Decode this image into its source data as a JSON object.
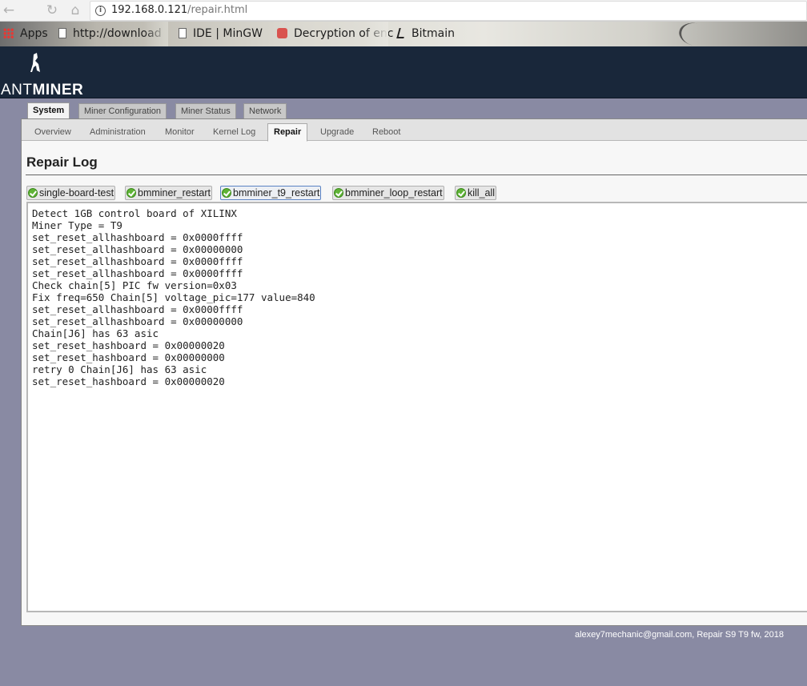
{
  "browser": {
    "url_host": "192.168.0.121",
    "url_path": "/repair.html",
    "bookmarks": [
      {
        "label": "Apps",
        "icon": "apps-grid-icon"
      },
      {
        "label": "http://download",
        "icon": "page-icon"
      },
      {
        "label": "IDE | MinGW",
        "icon": "page-icon"
      },
      {
        "label": "Decryption of enc",
        "icon": "page-icon"
      },
      {
        "label": "Bitmain",
        "icon": "antminer-icon"
      }
    ]
  },
  "header": {
    "logo_part1": "ANT",
    "logo_part2": "MINER"
  },
  "tabs": [
    {
      "label": "System",
      "active": true
    },
    {
      "label": "Miner Configuration",
      "active": false
    },
    {
      "label": "Miner Status",
      "active": false
    },
    {
      "label": "Network",
      "active": false
    }
  ],
  "subtabs": [
    {
      "label": "Overview"
    },
    {
      "label": "Administration"
    },
    {
      "label": "Monitor"
    },
    {
      "label": "Kernel Log"
    },
    {
      "label": "Repair",
      "active": true
    },
    {
      "label": "Upgrade"
    },
    {
      "label": "Reboot"
    }
  ],
  "page_title": "Repair Log",
  "actions": [
    {
      "label": "single-board-test"
    },
    {
      "label": "bmminer_restart"
    },
    {
      "label": "bmminer_t9_restart",
      "active": true
    },
    {
      "label": "bmminer_loop_restart"
    },
    {
      "label": "kill_all"
    }
  ],
  "log_lines": [
    "Detect 1GB control board of XILINX",
    "Miner Type = T9",
    "set_reset_allhashboard = 0x0000ffff",
    "set_reset_allhashboard = 0x00000000",
    "set_reset_allhashboard = 0x0000ffff",
    "set_reset_allhashboard = 0x0000ffff",
    "Check chain[5] PIC fw version=0x03",
    "Fix freq=650 Chain[5] voltage_pic=177 value=840",
    "set_reset_allhashboard = 0x0000ffff",
    "set_reset_allhashboard = 0x00000000",
    "Chain[J6] has 63 asic",
    "set_reset_hashboard = 0x00000020",
    "set_reset_hashboard = 0x00000000",
    "retry 0 Chain[J6] has 63 asic",
    "set_reset_hashboard = 0x00000020"
  ],
  "footer": "alexey7mechanic@gmail.com, Repair S9 T9 fw, 2018",
  "colors": {
    "header_bg": "#19273a",
    "page_bg": "#898aa3",
    "check_green": "#5fb336"
  }
}
